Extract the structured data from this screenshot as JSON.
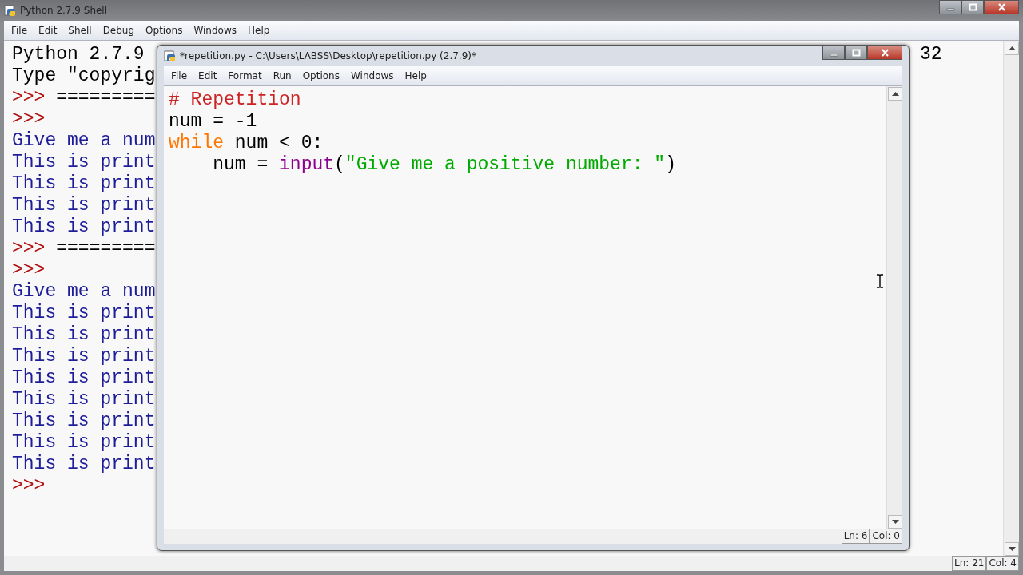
{
  "shell": {
    "title": "Python 2.7.9 Shell",
    "menu": [
      "File",
      "Edit",
      "Shell",
      "Debug",
      "Options",
      "Windows",
      "Help"
    ],
    "lines": [
      {
        "segments": [
          {
            "kind": "plain",
            "text": "Python 2.7.9"
          }
        ]
      },
      {
        "segments": [
          {
            "kind": "plain",
            "text": "Type \"copyrig"
          }
        ]
      },
      {
        "segments": [
          {
            "kind": "prompt",
            "text": ">>>"
          },
          {
            "kind": "plain",
            "text": " ========="
          }
        ]
      },
      {
        "segments": [
          {
            "kind": "prompt",
            "text": ">>>"
          }
        ]
      },
      {
        "segments": [
          {
            "kind": "output",
            "text": "Give me a num"
          }
        ]
      },
      {
        "segments": [
          {
            "kind": "output",
            "text": "This is print"
          }
        ]
      },
      {
        "segments": [
          {
            "kind": "output",
            "text": "This is print"
          }
        ]
      },
      {
        "segments": [
          {
            "kind": "output",
            "text": "This is print"
          }
        ]
      },
      {
        "segments": [
          {
            "kind": "output",
            "text": "This is print"
          }
        ]
      },
      {
        "segments": [
          {
            "kind": "prompt",
            "text": ">>>"
          },
          {
            "kind": "plain",
            "text": " ========="
          }
        ]
      },
      {
        "segments": [
          {
            "kind": "prompt",
            "text": ">>>"
          }
        ]
      },
      {
        "segments": [
          {
            "kind": "output",
            "text": "Give me a num"
          }
        ]
      },
      {
        "segments": [
          {
            "kind": "output",
            "text": "This is print"
          }
        ]
      },
      {
        "segments": [
          {
            "kind": "output",
            "text": "This is print"
          }
        ]
      },
      {
        "segments": [
          {
            "kind": "output",
            "text": "This is print"
          }
        ]
      },
      {
        "segments": [
          {
            "kind": "output",
            "text": "This is print"
          }
        ]
      },
      {
        "segments": [
          {
            "kind": "output",
            "text": "This is print"
          }
        ]
      },
      {
        "segments": [
          {
            "kind": "output",
            "text": "This is print"
          }
        ]
      },
      {
        "segments": [
          {
            "kind": "output",
            "text": "This is print"
          }
        ]
      },
      {
        "segments": [
          {
            "kind": "output",
            "text": "This is print"
          }
        ]
      },
      {
        "segments": [
          {
            "kind": "prompt",
            "text": ">>>"
          }
        ]
      }
    ],
    "right_text": "32",
    "status": [
      "Ln: 21",
      "Col: 4"
    ]
  },
  "editor": {
    "title": "*repetition.py - C:\\Users\\LABSS\\Desktop\\repetition.py (2.7.9)*",
    "menu": [
      "File",
      "Edit",
      "Format",
      "Run",
      "Options",
      "Windows",
      "Help"
    ],
    "lines": [
      {
        "segments": [
          {
            "kind": "comment",
            "text": "# Repetition"
          }
        ]
      },
      {
        "segments": [
          {
            "kind": "plain",
            "text": "num = -1"
          }
        ]
      },
      {
        "segments": [
          {
            "kind": "keyword",
            "text": "while"
          },
          {
            "kind": "plain",
            "text": " num < 0:"
          }
        ]
      },
      {
        "segments": [
          {
            "kind": "plain",
            "text": "    num = "
          },
          {
            "kind": "builtin",
            "text": "input"
          },
          {
            "kind": "plain",
            "text": "("
          },
          {
            "kind": "string",
            "text": "\"Give me a positive number: \""
          },
          {
            "kind": "plain",
            "text": ")"
          }
        ]
      }
    ],
    "status": [
      "Ln: 6",
      "Col: 0"
    ]
  }
}
